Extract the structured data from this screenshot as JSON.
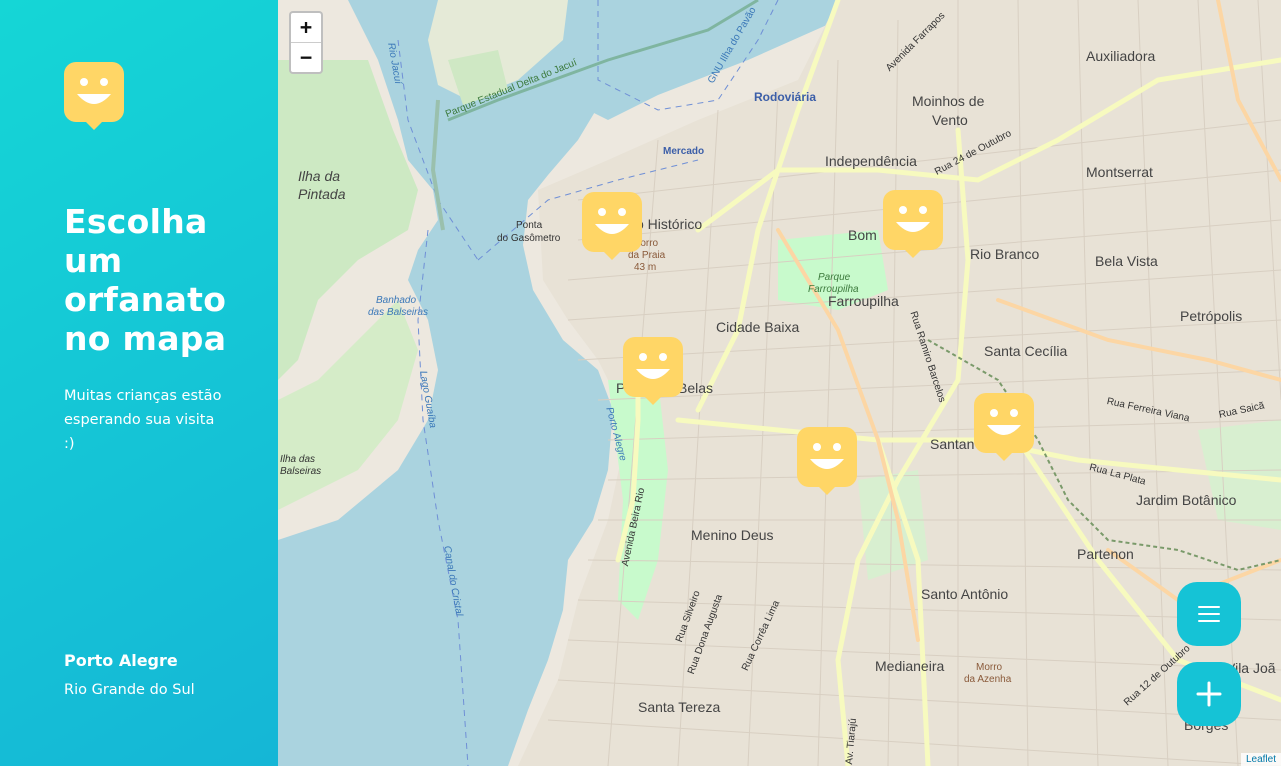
{
  "sidebar": {
    "title": "Escolha um orfanato no mapa",
    "subtitle": "Muitas crianças estão esperando sua visita :)",
    "city": "Porto Alegre",
    "state": "Rio Grande do Sul"
  },
  "map": {
    "zoom_in": "+",
    "zoom_out": "−",
    "attribution": "Leaflet",
    "labels": {
      "rodoviaria": "Rodoviária",
      "mercado": "Mercado",
      "auxiliadora": "Auxiliadora",
      "moinhos": "Moinhos de",
      "vento": "Vento",
      "independencia": "Independência",
      "montserrat": "Montserrat",
      "ilha_pintada_1": "Ilha da",
      "ilha_pintada_2": "Pintada",
      "ponta_1": "Ponta",
      "ponta_2": "do Gasômetro",
      "historico": "o Histórico",
      "bom": "Bom",
      "rio_branco": "Rio Branco",
      "bela_vista": "Bela Vista",
      "morro_praia_1": "Morro",
      "morro_praia_2": "da Praia",
      "morro_praia_3": "43 m",
      "parque_farroupilha_1": "Parque",
      "parque_farroupilha_2": "Farroupilha",
      "farroupilha": "Farroupilha",
      "petropolis": "Petrópolis",
      "banhado_1": "Banhado",
      "banhado_2": "das Balseiras",
      "cidade_baixa": "Cidade Baixa",
      "santa_cecilia": "Santa Cecília",
      "belas": "Belas",
      "praia": "Pr",
      "santana": "Santan",
      "lago_guaiba": "Lago Guaíba",
      "ilha_balseiras_1": "Ilha das",
      "ilha_balseiras_2": "Balseiras",
      "jardim_botanico": "Jardim Botânico",
      "menino_deus": "Menino Deus",
      "partenon": "Partenon",
      "canal_cristal": "Canal do Cristal",
      "santo_antonio": "Santo Antônio",
      "medianeira": "Medianeira",
      "morro_azenha_1": "Morro",
      "morro_azenha_2": "da Azenha",
      "santa_tereza": "Santa Tereza",
      "vila_joao": "Vila Joã",
      "borges": "Borges",
      "rio_jacui": "Rio Jacuí",
      "parque_delta": "Parque Estadual Delta do Jacuí",
      "gnu": "GNU Ilha do Pavão",
      "av_farrapos": "Avenida Farrapos",
      "rua_24": "Rua 24 de Outubro",
      "rua_ramiro": "Rua Ramiro Barcelos",
      "rua_ferreira": "Rua Ferreira Viana",
      "rua_saica": "Rua Saicã",
      "rua_plata": "Rua La Plata",
      "av_beira_rio": "Avenida Beira Rio",
      "rua_silveiro": "Rua Silveiro",
      "rua_dona_augusta": "Rua Dona Augusta",
      "rua_correa_lima": "Rua Corrêa Lima",
      "rua_12": "Rua 12 de Outubro",
      "av_tiaraju": "Av. Tiarajú",
      "porto_alegre_v": "Porto Alegre"
    }
  },
  "colors": {
    "sidebar_start": "#15d6d6",
    "sidebar_end": "#15b6d6",
    "marker": "#ffd666",
    "fab": "#15c3d6",
    "water": "#aad3df",
    "park": "#c8facc",
    "road_major": "#f7fabf"
  },
  "icons": {
    "logo": "smiley-pin-icon",
    "marker": "smiley-pin-icon",
    "menu": "menu-icon",
    "add": "plus-icon"
  }
}
